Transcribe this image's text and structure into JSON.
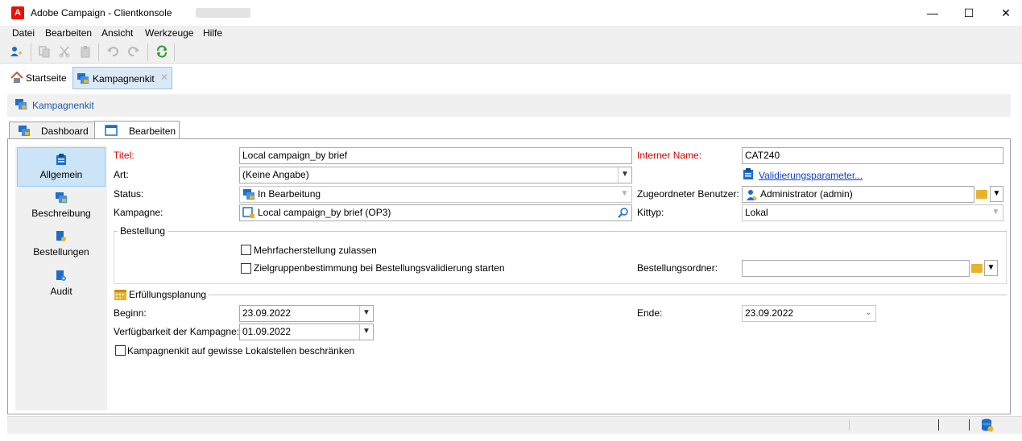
{
  "window": {
    "title": "Adobe Campaign - Clientkonsole",
    "logo_letter": "A",
    "controls": {
      "minimize": "—",
      "maximize": "☐",
      "close": "✕"
    }
  },
  "menu": [
    {
      "label": "Datei"
    },
    {
      "label": "Bearbeiten"
    },
    {
      "label": "Ansicht"
    },
    {
      "label": "Werkzeuge"
    },
    {
      "label": "Hilfe"
    }
  ],
  "toolbar": {
    "icons": [
      "new-user-icon",
      "copy-icon",
      "cut-icon",
      "paste-icon",
      "undo-icon",
      "redo-icon",
      "refresh-icon"
    ]
  },
  "tabs": {
    "home": "Startseite",
    "kit": "Kampagnenkit",
    "close_glyph": "✕"
  },
  "breadcrumb": "Kampagnenkit",
  "inner_tabs": {
    "dashboard": "Dashboard",
    "edit": "Bearbeiten"
  },
  "sidebar": [
    {
      "label": "Allgemein"
    },
    {
      "label": "Beschreibung"
    },
    {
      "label": "Bestellungen"
    },
    {
      "label": "Audit"
    }
  ],
  "form": {
    "titel_label": "Titel:",
    "titel_value": "Local campaign_by brief",
    "art_label": "Art:",
    "art_value": "(Keine Angabe)",
    "status_label": "Status:",
    "status_value": "In Bearbeitung",
    "kampagne_label": "Kampagne:",
    "kampagne_value": "Local campaign_by brief (OP3)",
    "interner_name_label": "Interner Name:",
    "interner_name_value": "CAT240",
    "validierung_link": "Validierungsparameter...",
    "benutzer_label": "Zugeordneter Benutzer:",
    "benutzer_value": "Administrator (admin)",
    "kittyp_label": "Kittyp:",
    "kittyp_value": "Lokal",
    "bestellung_group": "Bestellung",
    "mehrfach_label": "Mehrfacherstellung zulassen",
    "zielgruppen_label": "Zielgruppenbestimmung bei Bestellungsvalidierung starten",
    "bestellungsordner_label": "Bestellungsordner:",
    "bestellungsordner_value": "",
    "erfuellung_group": "Erfüllungsplanung",
    "beginn_label": "Beginn:",
    "beginn_value": "23.09.2022",
    "ende_label": "Ende:",
    "ende_value": "23.09.2022",
    "verfuegbarkeit_label": "Verfügbarkeit der Kampagne:",
    "verfuegbarkeit_value": "01.09.2022",
    "lokal_label": "Kampagnenkit auf gewisse Lokalstellen beschränken"
  },
  "colors": {
    "accent": "#1c6ec7",
    "required": "#d40000",
    "link": "#0b3fbf",
    "selected_bg": "#cce4f7"
  }
}
